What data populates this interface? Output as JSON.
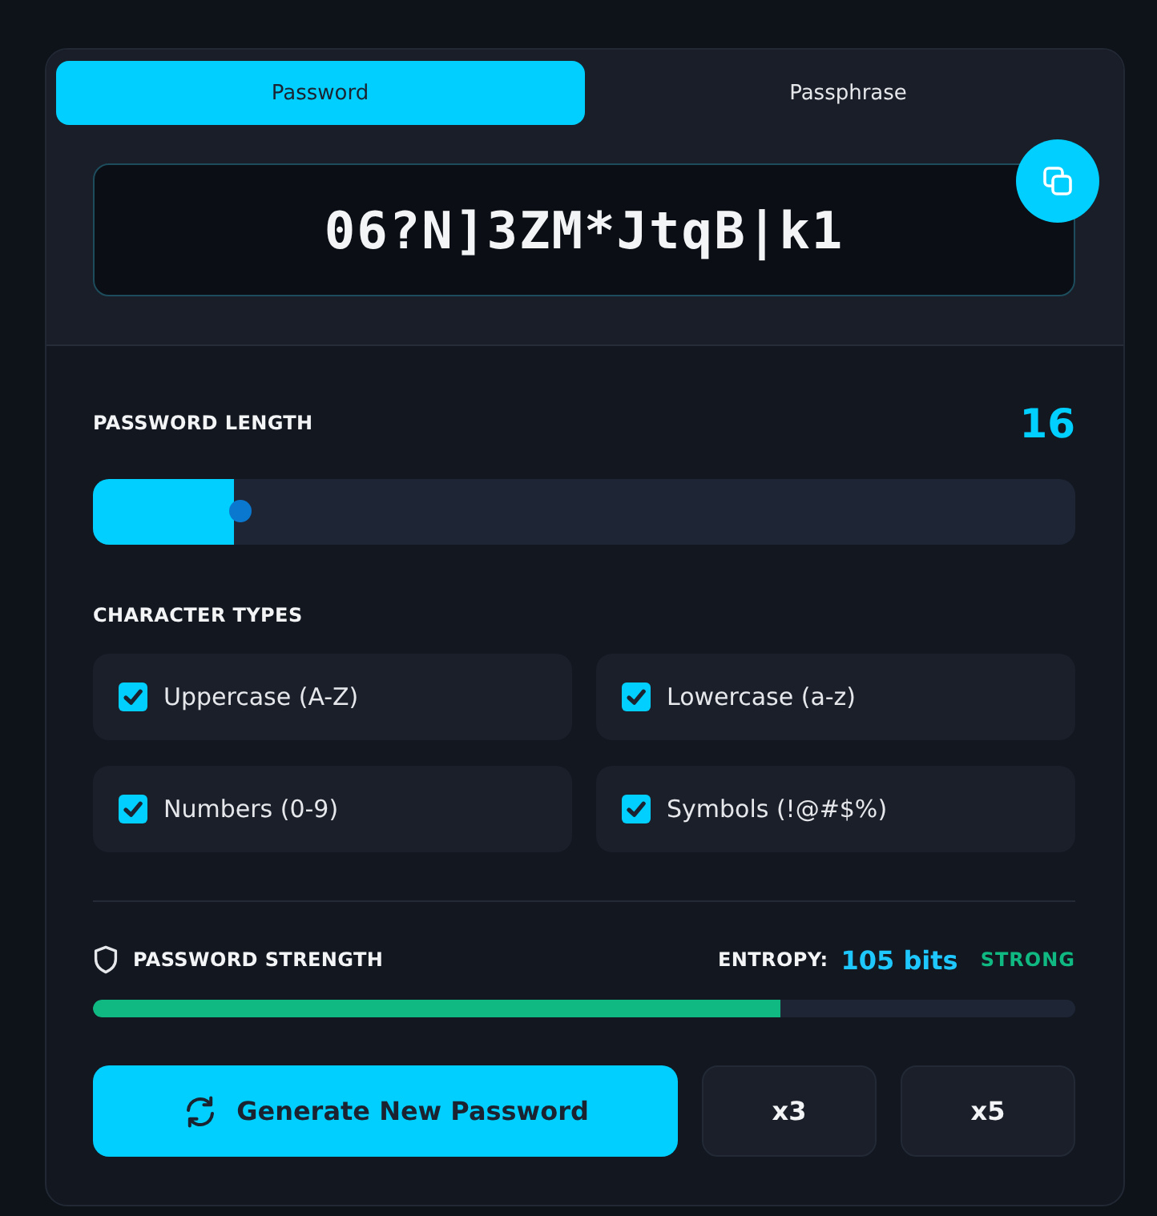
{
  "tabs": [
    {
      "label": "Password",
      "selected": true
    },
    {
      "label": "Passphrase",
      "selected": false
    }
  ],
  "password_field": {
    "value": "06?N]3ZM*JtqB|k1"
  },
  "length": {
    "label": "PASSWORD LENGTH",
    "value": "16",
    "slider": {
      "level": 0.144
    }
  },
  "character_types": {
    "label": "CHARACTER TYPES",
    "options": [
      {
        "label": "Uppercase (A-Z)",
        "checked": true
      },
      {
        "label": "Lowercase (a-z)",
        "checked": true
      },
      {
        "label": "Numbers (0-9)",
        "checked": true
      },
      {
        "label": "Symbols (!@#$%)",
        "checked": true
      }
    ]
  },
  "strength": {
    "label": "PASSWORD STRENGTH",
    "entropy_label": "ENTROPY:",
    "entropy_value": "105 bits",
    "rating": "STRONG",
    "level": 0.7
  },
  "buttons": [
    {
      "label": "Generate New Password",
      "kind": "primary"
    },
    {
      "label": "x3",
      "kind": "secondary"
    },
    {
      "label": "x5",
      "kind": "secondary"
    }
  ]
}
